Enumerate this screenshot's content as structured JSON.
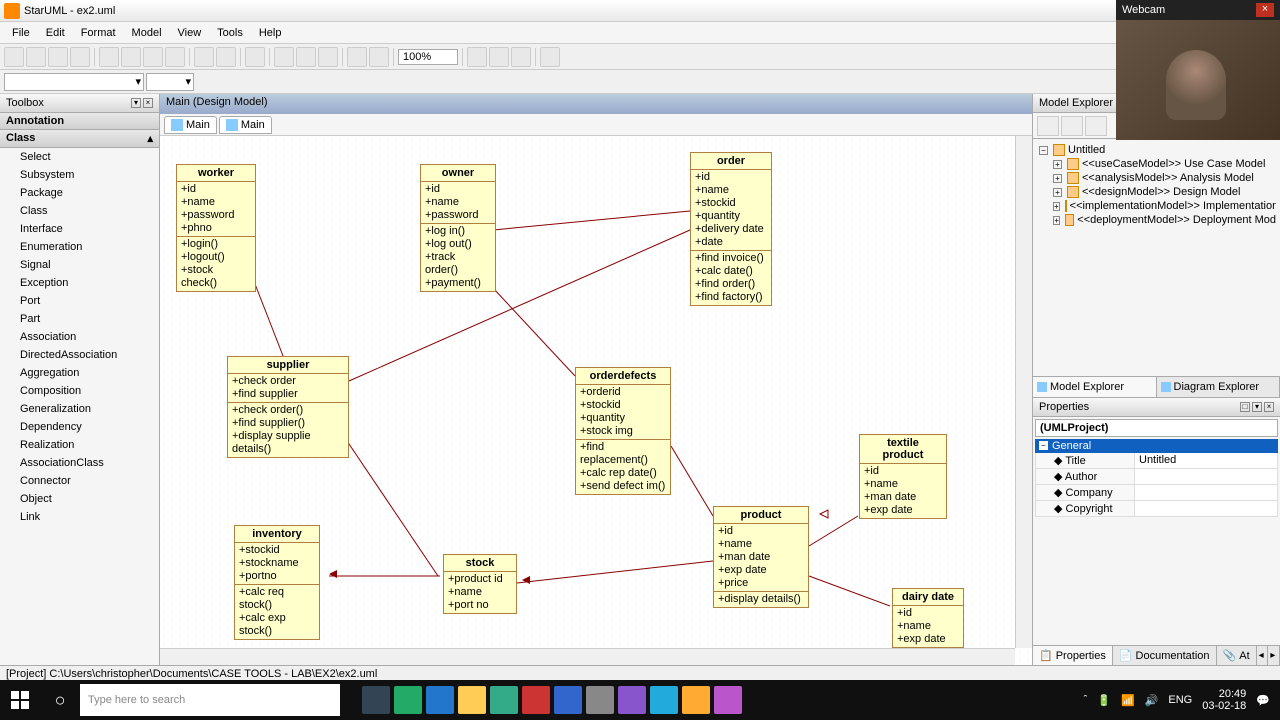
{
  "title": "StarUML - ex2.uml",
  "menu": [
    "File",
    "Edit",
    "Format",
    "Model",
    "View",
    "Tools",
    "Help"
  ],
  "zoom": "100%",
  "toolbox": {
    "title": "Toolbox",
    "sections": {
      "annotation": "Annotation",
      "class": "Class"
    },
    "items": [
      "Select",
      "Subsystem",
      "Package",
      "Class",
      "Interface",
      "Enumeration",
      "Signal",
      "Exception",
      "Port",
      "Part",
      "Association",
      "DirectedAssociation",
      "Aggregation",
      "Composition",
      "Generalization",
      "Dependency",
      "Realization",
      "AssociationClass",
      "Connector",
      "Object",
      "Link"
    ]
  },
  "canvas": {
    "tabTitle": "Main (Design Model)",
    "tabs": [
      "Main",
      "Main"
    ]
  },
  "classes": {
    "worker": {
      "name": "worker",
      "attrs": [
        "+id",
        "+name",
        "+password",
        "+phno"
      ],
      "ops": [
        "+login()",
        "+logout()",
        "+stock check()"
      ]
    },
    "owner": {
      "name": "owner",
      "attrs": [
        "+id",
        "+name",
        "+password"
      ],
      "ops": [
        "+log in()",
        "+log out()",
        "+track order()",
        "+payment()"
      ]
    },
    "order": {
      "name": "order",
      "attrs": [
        "+id",
        "+name",
        "+stockid",
        "+quantity",
        "+delivery date",
        "+date"
      ],
      "ops": [
        "+find invoice()",
        "+calc date()",
        "+find order()",
        "+find factory()"
      ]
    },
    "supplier": {
      "name": "supplier",
      "attrs": [
        "+check order",
        "+find supplier"
      ],
      "ops": [
        "+check order()",
        "+find supplier()",
        "+display supplie details()"
      ]
    },
    "orderdefects": {
      "name": "orderdefects",
      "attrs": [
        "+orderid",
        "+stockid",
        "+quantity",
        "+stock img"
      ],
      "ops": [
        "+find replacement()",
        "+calc rep date()",
        "+send defect im()"
      ]
    },
    "textile": {
      "name": "textile product",
      "attrs": [
        "+id",
        "+name",
        "+man date",
        "+exp date"
      ],
      "ops": []
    },
    "inventory": {
      "name": "inventory",
      "attrs": [
        "+stockid",
        "+stockname",
        "+portno"
      ],
      "ops": [
        "+calc req stock()",
        "+calc exp stock()"
      ]
    },
    "product": {
      "name": "product",
      "attrs": [
        "+id",
        "+name",
        "+man date",
        "+exp date",
        "+price"
      ],
      "ops": [
        "+display details()"
      ]
    },
    "stock": {
      "name": "stock",
      "attrs": [
        "+product id",
        "+name",
        "+port no"
      ],
      "ops": []
    },
    "dairy": {
      "name": "dairy date",
      "attrs": [
        "+id",
        "+name",
        "+exp date"
      ],
      "ops": []
    }
  },
  "explorer": {
    "title": "Model Explorer",
    "root": "Untitled",
    "items": [
      "<<useCaseModel>> Use Case Model",
      "<<analysisModel>> Analysis Model",
      "<<designModel>> Design Model",
      "<<implementationModel>> Implementation",
      "<<deploymentModel>> Deployment Mod"
    ],
    "tabs": [
      "Model Explorer",
      "Diagram Explorer"
    ]
  },
  "properties": {
    "title": "Properties",
    "object": "(UMLProject)",
    "category": "General",
    "rows": [
      {
        "k": "Title",
        "v": "Untitled"
      },
      {
        "k": "Author",
        "v": ""
      },
      {
        "k": "Company",
        "v": ""
      },
      {
        "k": "Copyright",
        "v": ""
      }
    ],
    "tabs": [
      "Properties",
      "Documentation",
      "At"
    ]
  },
  "statusbar": "[Project] C:\\Users\\christopher\\Documents\\CASE TOOLS - LAB\\EX2\\ex2.uml",
  "taskbar": {
    "search": "Type here to search",
    "time": "20:49",
    "date": "03-02-18",
    "lang": "ENG"
  },
  "webcam": "Webcam"
}
